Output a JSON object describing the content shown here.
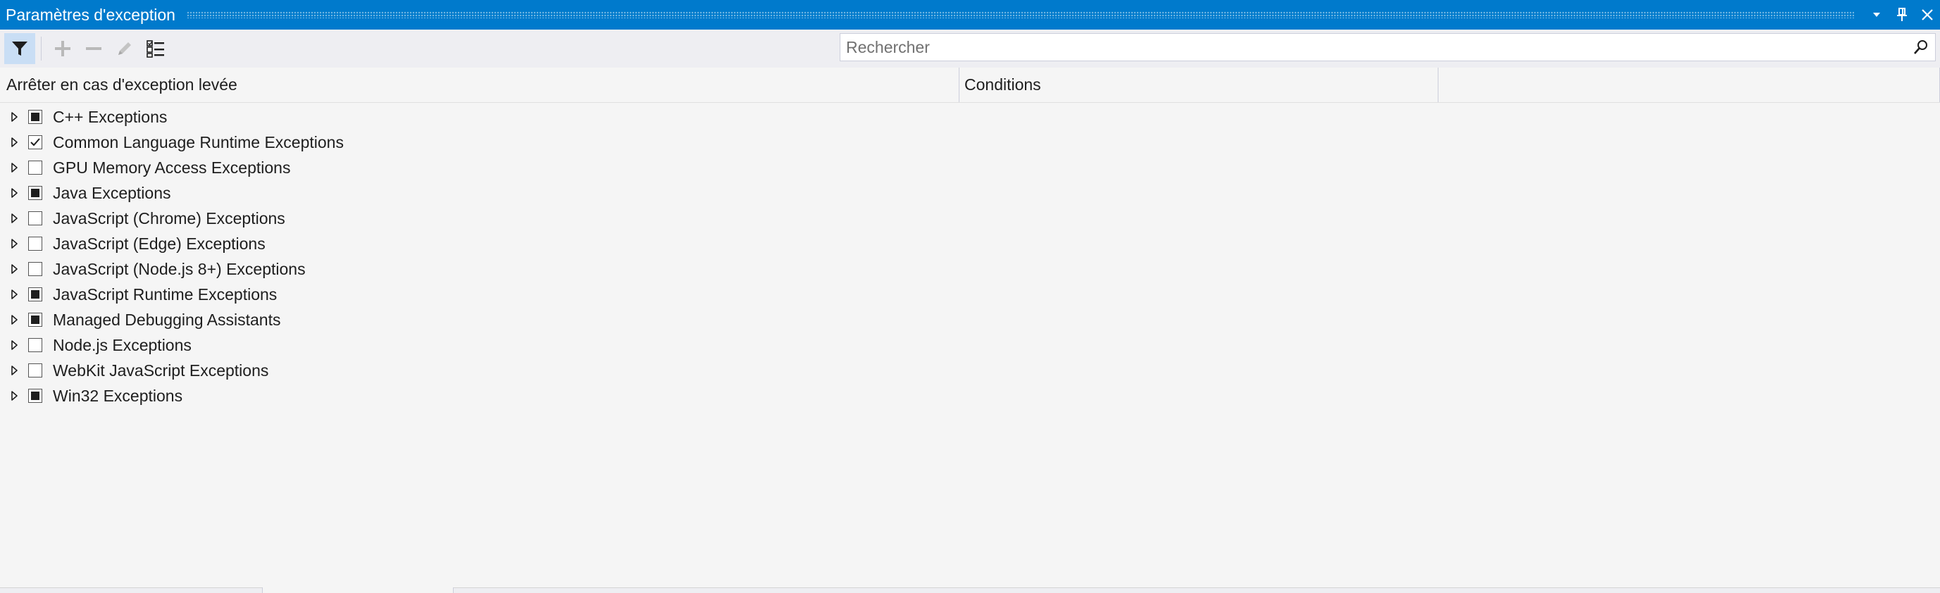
{
  "window": {
    "title": "Paramètres d'exception"
  },
  "toolbar": {
    "filter": "filter-icon",
    "add": "plus-icon",
    "remove": "minus-icon",
    "edit": "pencil-icon",
    "restore_defaults": "list-checkbox-icon"
  },
  "search": {
    "placeholder": "Rechercher",
    "value": ""
  },
  "columns": [
    "Arrêter en cas d'exception levée",
    "Conditions",
    ""
  ],
  "categories": [
    {
      "label": "C++ Exceptions",
      "state": "partial"
    },
    {
      "label": "Common Language Runtime Exceptions",
      "state": "checked"
    },
    {
      "label": "GPU Memory Access Exceptions",
      "state": "unchecked"
    },
    {
      "label": "Java Exceptions",
      "state": "partial"
    },
    {
      "label": "JavaScript (Chrome) Exceptions",
      "state": "unchecked"
    },
    {
      "label": "JavaScript (Edge) Exceptions",
      "state": "unchecked"
    },
    {
      "label": "JavaScript (Node.js 8+) Exceptions",
      "state": "unchecked"
    },
    {
      "label": "JavaScript Runtime Exceptions",
      "state": "partial"
    },
    {
      "label": "Managed Debugging Assistants",
      "state": "partial"
    },
    {
      "label": "Node.js Exceptions",
      "state": "unchecked"
    },
    {
      "label": "WebKit JavaScript Exceptions",
      "state": "unchecked"
    },
    {
      "label": "Win32 Exceptions",
      "state": "partial"
    }
  ],
  "colors": {
    "accent": "#007acc",
    "background": "#f5f5f5",
    "toolbar": "#eeeef2",
    "text": "#1e1e1e"
  }
}
